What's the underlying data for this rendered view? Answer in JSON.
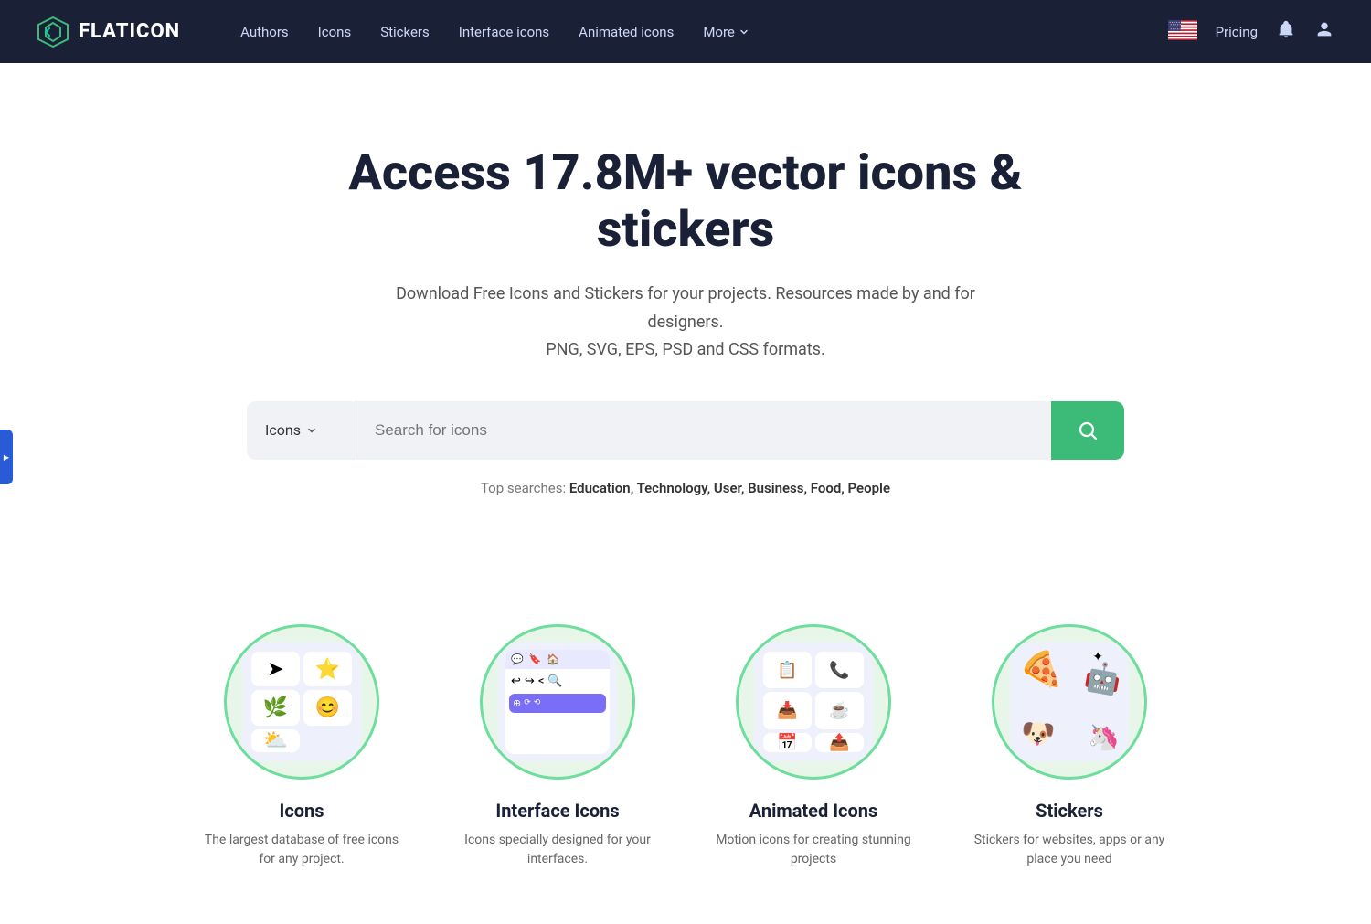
{
  "navbar": {
    "brand": "FLATICON",
    "links": [
      {
        "id": "authors",
        "label": "Authors"
      },
      {
        "id": "icons",
        "label": "Icons"
      },
      {
        "id": "stickers",
        "label": "Stickers"
      },
      {
        "id": "interface-icons",
        "label": "Interface icons"
      },
      {
        "id": "animated-icons",
        "label": "Animated icons"
      },
      {
        "id": "more",
        "label": "More"
      }
    ],
    "pricing": "Pricing"
  },
  "hero": {
    "title": "Access 17.8M+ vector icons & stickers",
    "subtitle_line1": "Download Free Icons and Stickers for your projects. Resources made by and for designers.",
    "subtitle_line2": "PNG, SVG, EPS, PSD and CSS formats."
  },
  "search": {
    "filter_label": "Icons",
    "placeholder": "Search for icons",
    "button_aria": "Search"
  },
  "top_searches": {
    "label": "Top searches:",
    "terms": [
      "Education",
      "Technology",
      "User",
      "Business",
      "Food",
      "People"
    ]
  },
  "categories": [
    {
      "id": "icons-cat",
      "title": "Icons",
      "desc": "The largest database of free icons for any project."
    },
    {
      "id": "interface-icons-cat",
      "title": "Interface Icons",
      "desc": "Icons specially designed for your interfaces."
    },
    {
      "id": "animated-icons-cat",
      "title": "Animated Icons",
      "desc": "Motion icons for creating stunning projects"
    },
    {
      "id": "stickers-cat",
      "title": "Stickers",
      "desc": "Stickers for websites, apps or any place you need"
    }
  ],
  "colors": {
    "navbar_bg": "#1a2035",
    "accent_green": "#3cba78",
    "circle_border": "#6dde9b",
    "circle_bg": "#e8f5e9"
  }
}
